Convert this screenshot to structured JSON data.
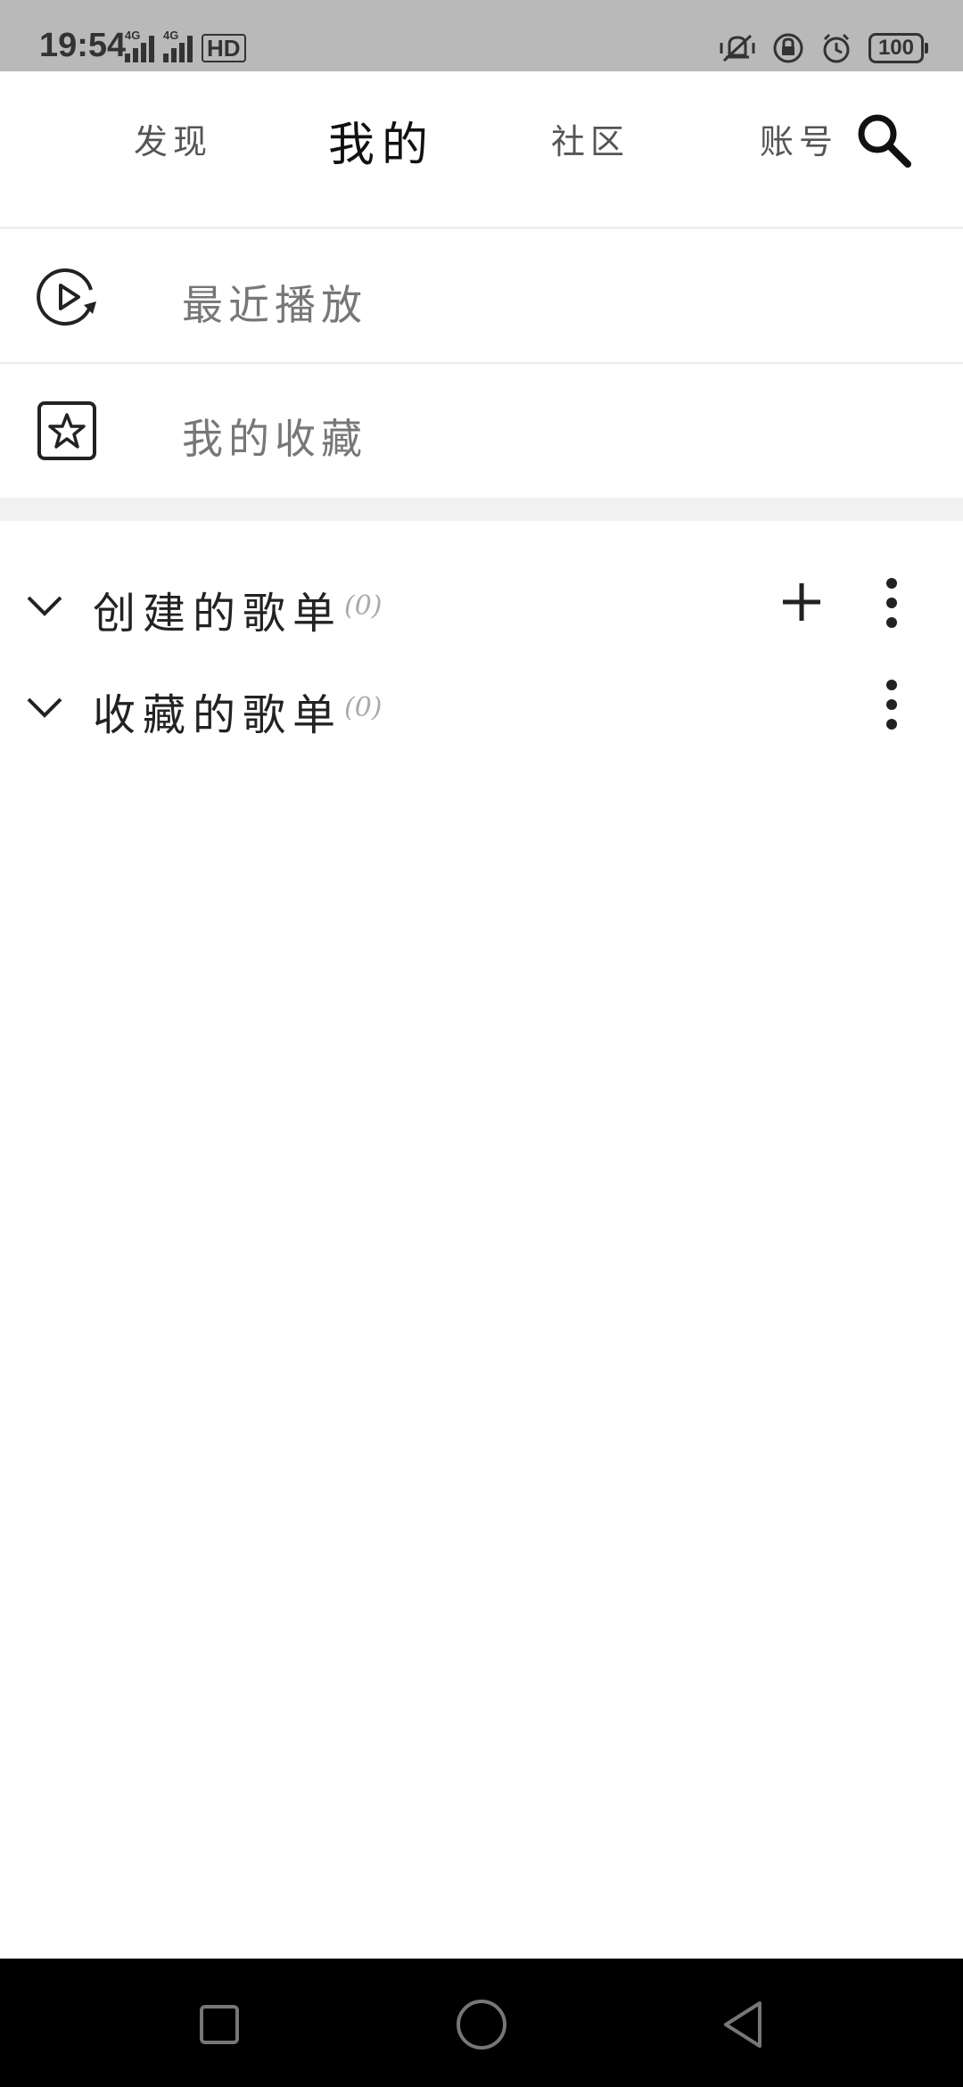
{
  "status_bar": {
    "time": "19:54",
    "sim1_label": "4G",
    "sim2_label": "4G",
    "hd_label": "HD",
    "battery": "100"
  },
  "nav": {
    "tabs": [
      {
        "label": "发现"
      },
      {
        "label": "我的"
      },
      {
        "label": "社区"
      },
      {
        "label": "账号"
      }
    ],
    "active_tab": "我的"
  },
  "menu": {
    "recent_label": "最近播放",
    "favorites_label": "我的收藏"
  },
  "playlists": {
    "created": {
      "title": "创建的歌单",
      "count": "(0)"
    },
    "collected": {
      "title": "收藏的歌单",
      "count": "(0)"
    }
  }
}
